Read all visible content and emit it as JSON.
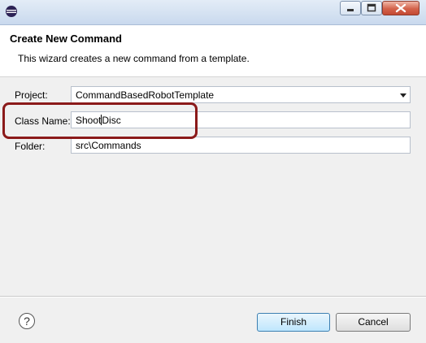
{
  "window": {
    "controls": {
      "minimize_icon": "minimize-icon",
      "maximize_icon": "maximize-icon",
      "close_icon": "close-icon"
    },
    "app_icon": "eclipse-icon"
  },
  "header": {
    "title": "Create New Command",
    "description": "This wizard creates a new command from a template."
  },
  "form": {
    "project_label": "Project:",
    "project_value": "CommandBasedRobotTemplate",
    "class_name_label": "Class Name:",
    "class_name_before_caret": "Shoot",
    "class_name_after_caret": "Disc",
    "folder_label": "Folder:",
    "folder_value": "src\\Commands"
  },
  "footer": {
    "help_symbol": "?",
    "finish_label": "Finish",
    "cancel_label": "Cancel"
  },
  "colors": {
    "highlight_border": "#8b1a1a",
    "finish_button": "#bee6fd"
  }
}
